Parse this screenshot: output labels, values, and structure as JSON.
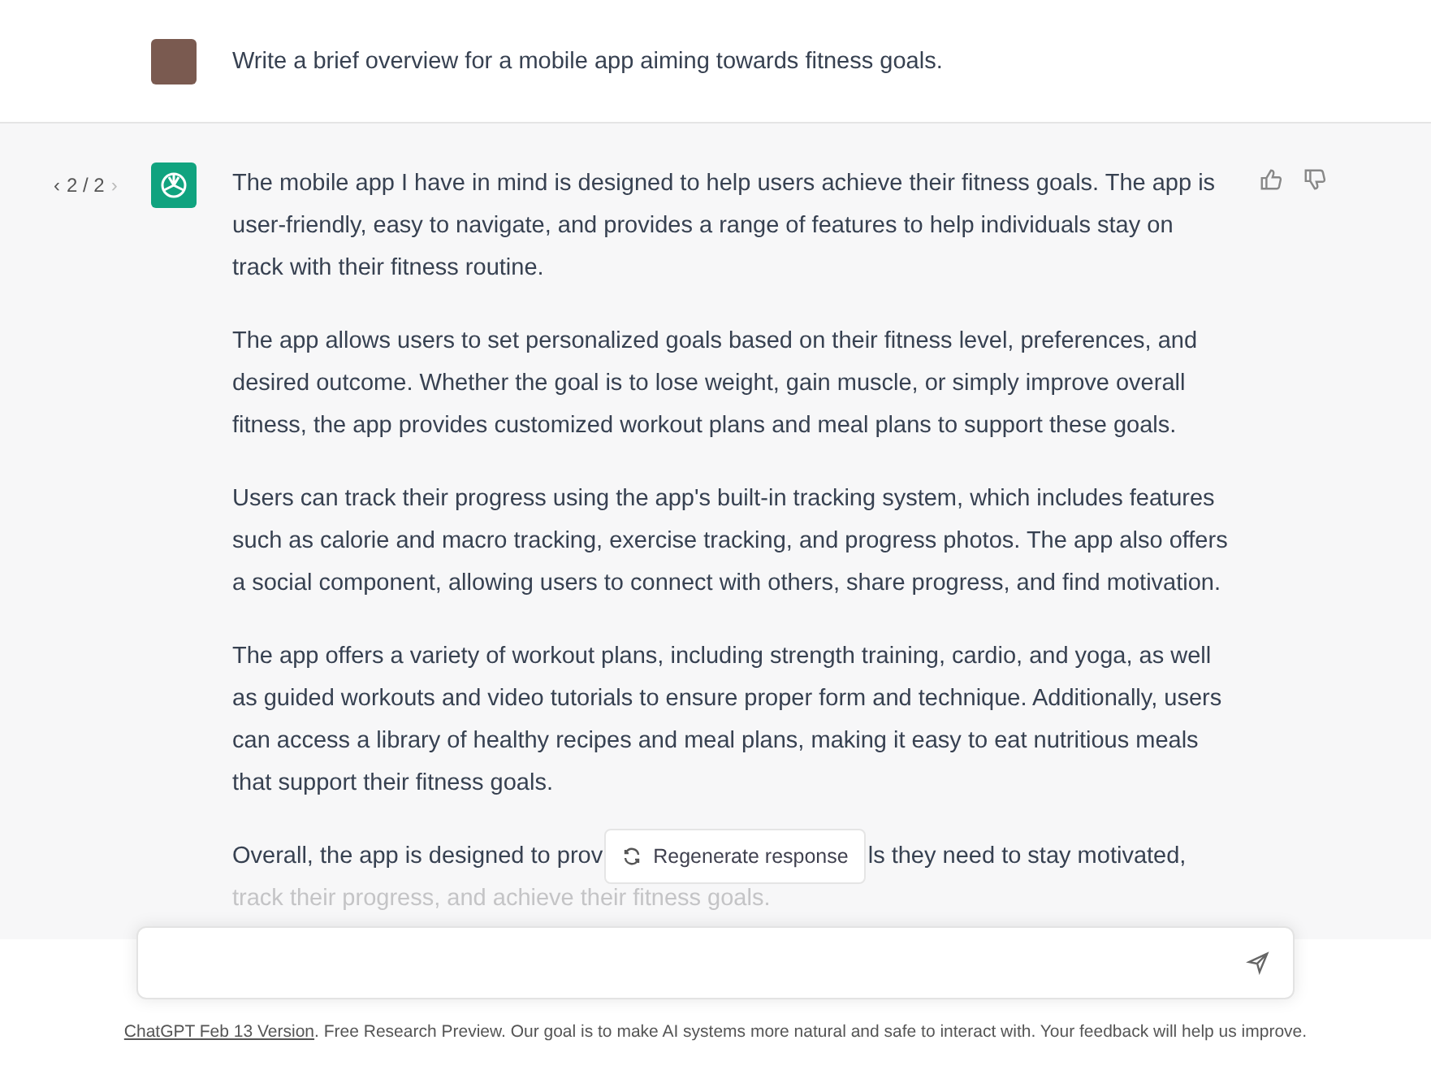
{
  "user_message": {
    "text": "Write a brief overview for a mobile app aiming towards fitness goals."
  },
  "response": {
    "pager": {
      "prev": "‹",
      "label": "2 / 2",
      "next": "›"
    },
    "paragraphs": [
      "The mobile app I have in mind is designed to help users achieve their fitness goals. The app is user-friendly, easy to navigate, and provides a range of features to help individuals stay on track with their fitness routine.",
      "The app allows users to set personalized goals based on their fitness level, preferences, and desired outcome. Whether the goal is to lose weight, gain muscle, or simply improve overall fitness, the app provides customized workout plans and meal plans to support these goals.",
      "Users can track their progress using the app's built-in tracking system, which includes features such as calorie and macro tracking, exercise tracking, and progress photos. The app also offers a social component, allowing users to connect with others, share progress, and find motivation.",
      "The app offers a variety of workout plans, including strength training, cardio, and yoga, as well as guided workouts and video tutorials to ensure proper form and technique. Additionally, users can access a library of healthy recipes and meal plans, making it easy to eat nutritious meals that support their fitness goals."
    ],
    "last_paragraph": {
      "before": "Overall, the app is designed to prov",
      "after": "ls they need to stay motivated,",
      "faded_line": "track their progress, and achieve their fitness goals."
    }
  },
  "regenerate_button": {
    "label": "Regenerate response"
  },
  "footer": {
    "link": "ChatGPT Feb 13 Version",
    "text": ". Free Research Preview. Our goal is to make AI systems more natural and safe to interact with. Your feedback will help us improve."
  }
}
